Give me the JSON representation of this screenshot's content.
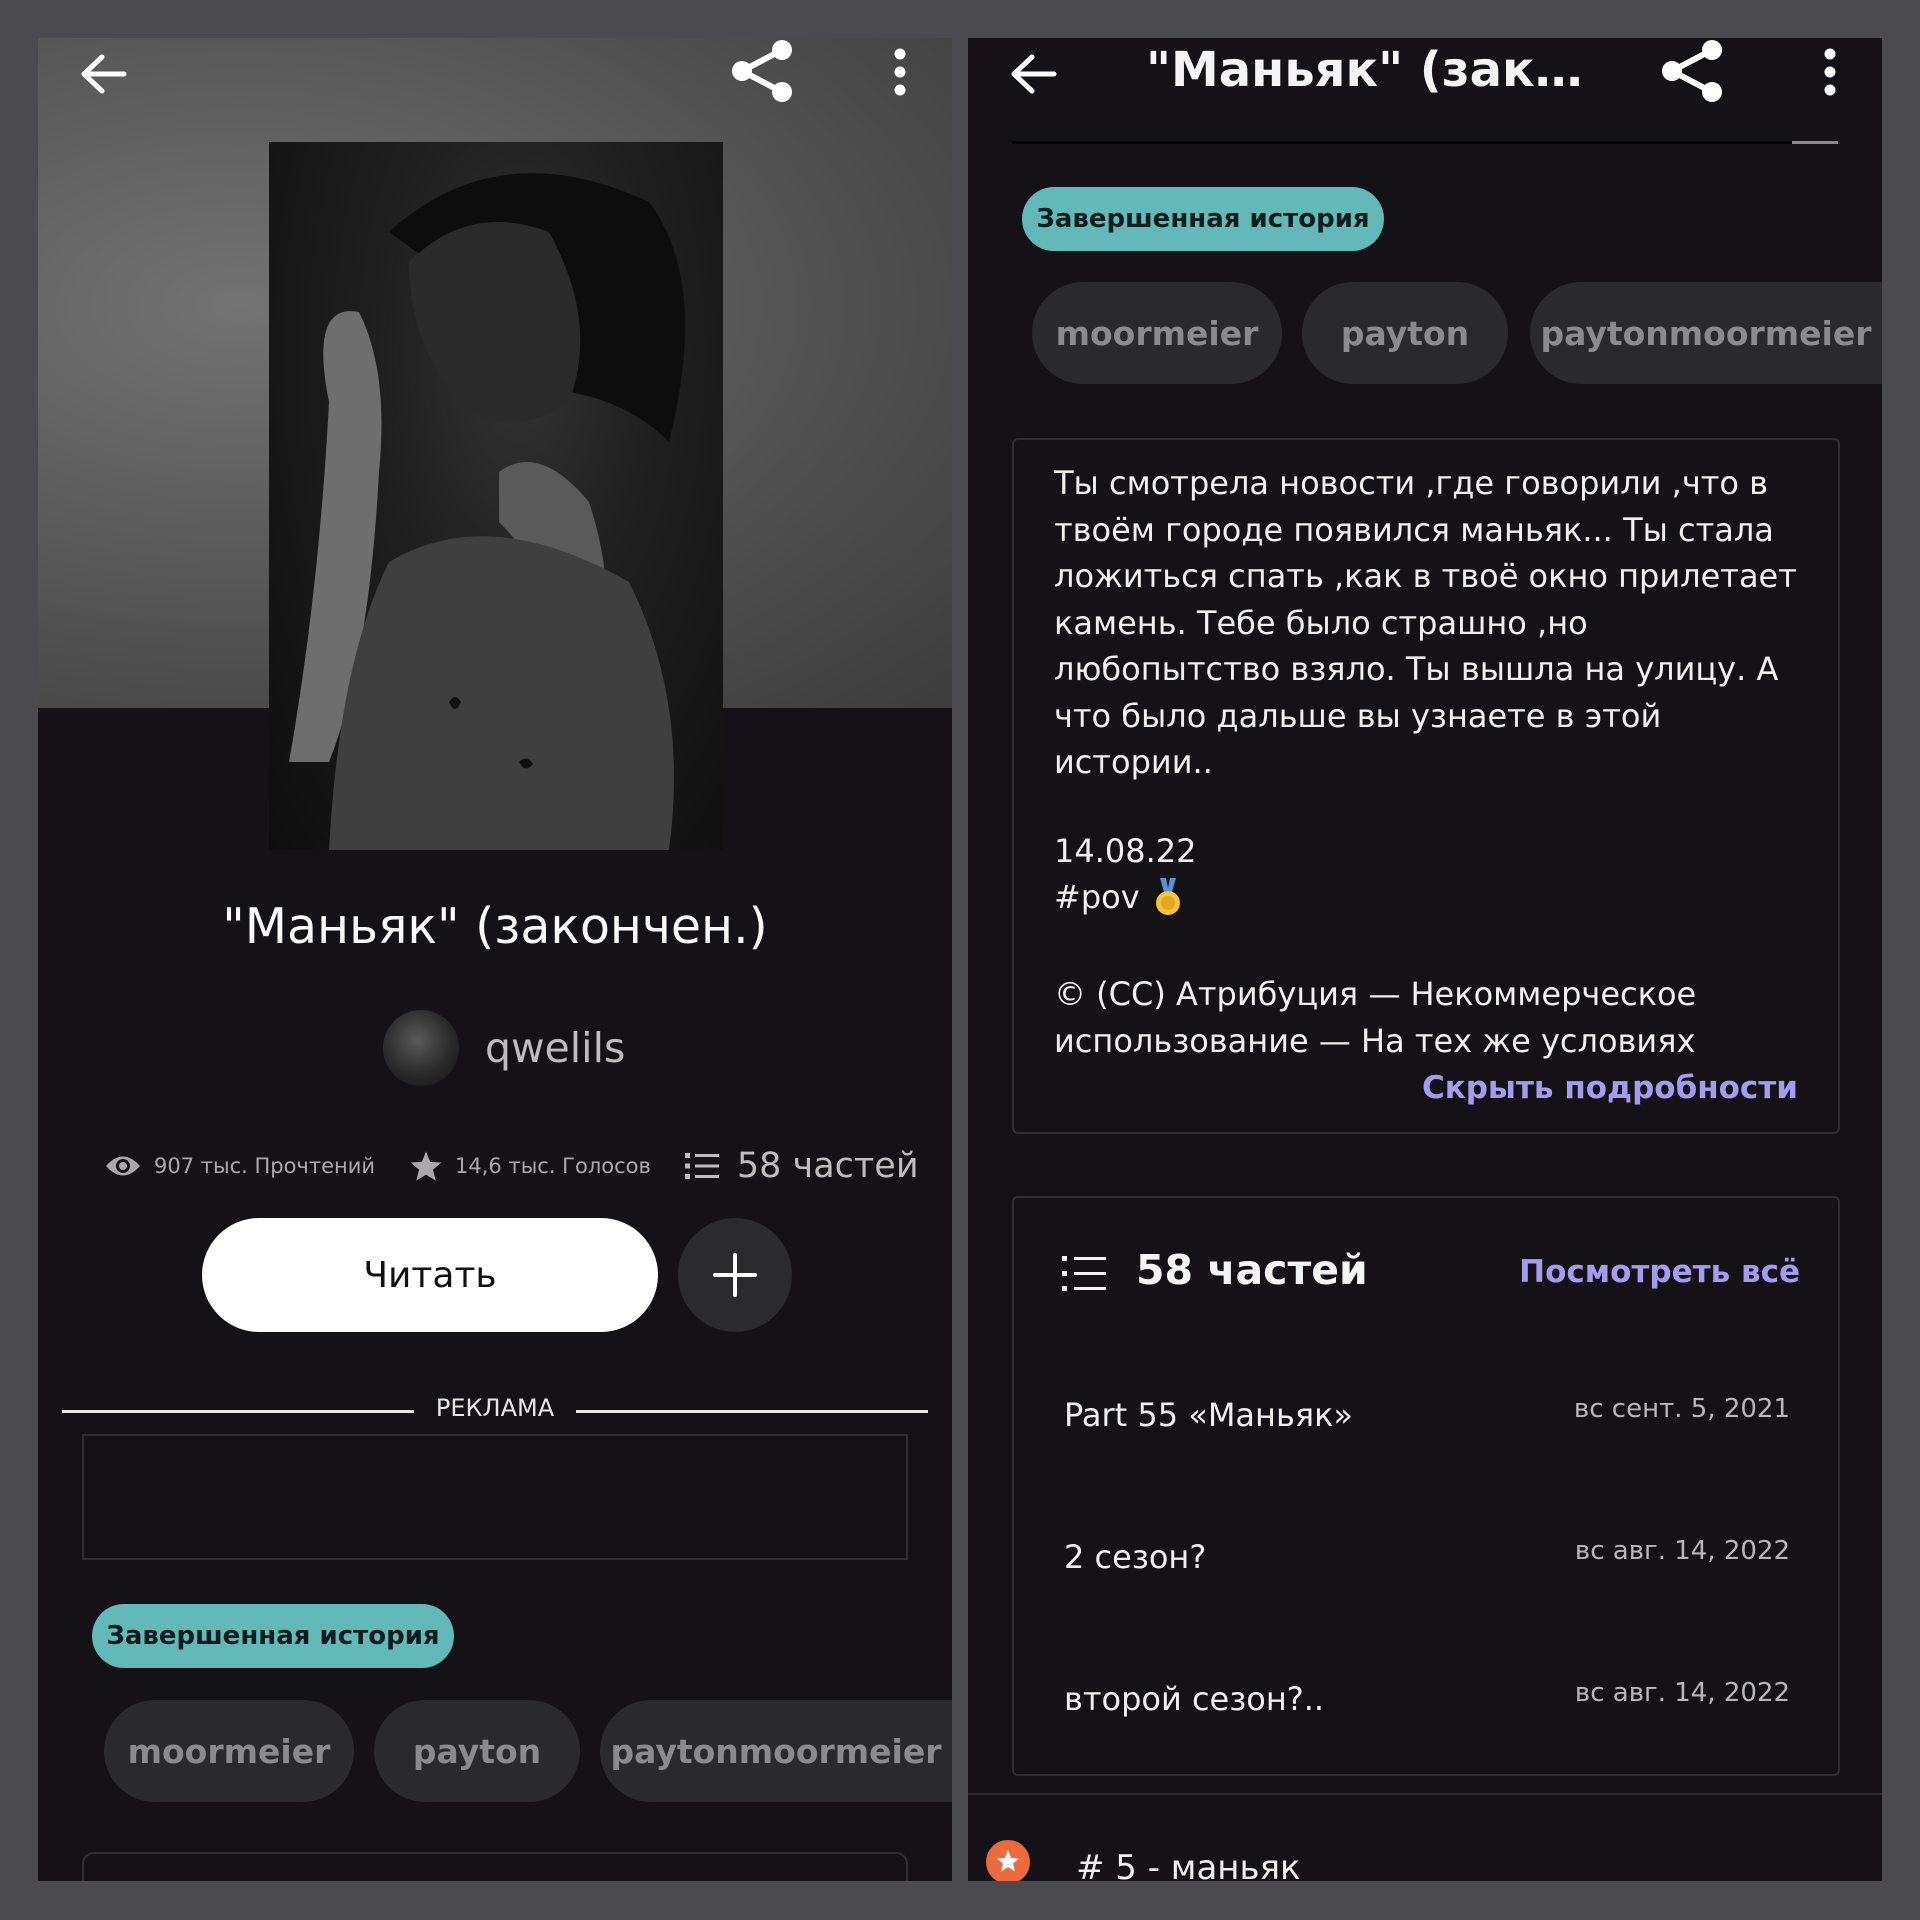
{
  "left": {
    "title": "\"Маньяк\" (закончен.)",
    "author": "qwelils",
    "stats": {
      "reads": "907 тыс. Прочтений",
      "votes": "14,6 тыс. Голосов",
      "parts": "58 частей"
    },
    "read_button": "Читать",
    "ad_label": "РЕКЛАМА",
    "completed_badge": "Завершенная история",
    "tags": [
      "moormeier",
      "payton",
      "paytonmoormeier"
    ]
  },
  "right": {
    "header_title": "\"Маньяк\" (закон...",
    "completed_badge": "Завершенная история",
    "tags": [
      "moormeier",
      "payton",
      "paytonmoormeier"
    ],
    "description": "Ты смотрела новости ,где говорили ,что в твоём городе появился маньяк... Ты стала ложиться спать ,как в твоё окно прилетает камень. Тебе было страшно ,но любопытство взяло. Ты вышла на улицу. А что было дальше вы узнаете в этой истории..",
    "date": "14.08.22",
    "hashtag": "#pov",
    "license": "© (CC) Атрибуция — Некоммерческое использование — На тех же условиях",
    "hide_details": "Скрыть подробности",
    "parts_header": "58 частей",
    "view_all": "Посмотреть всё",
    "parts": [
      {
        "title": "Part 55 «Маньяк»",
        "date": "вс сент. 5, 2021"
      },
      {
        "title": "2 сезон?",
        "date": "вс авг. 14, 2022"
      },
      {
        "title": "второй сезон?..",
        "date": "вс авг. 14, 2022"
      }
    ],
    "ranking": "# 5 - маньяк"
  },
  "colors": {
    "panel_bg": "#141217",
    "frame": "#4b4a4f",
    "completed_badge": "#62b9b8",
    "link": "#a59cf0",
    "tag_bg": "#2a292d"
  },
  "icons": [
    "back-arrow-icon",
    "share-icon",
    "more-vert-icon",
    "eye-icon",
    "star-icon",
    "list-icon",
    "plus-icon",
    "medal-icon",
    "rank-star-icon"
  ]
}
